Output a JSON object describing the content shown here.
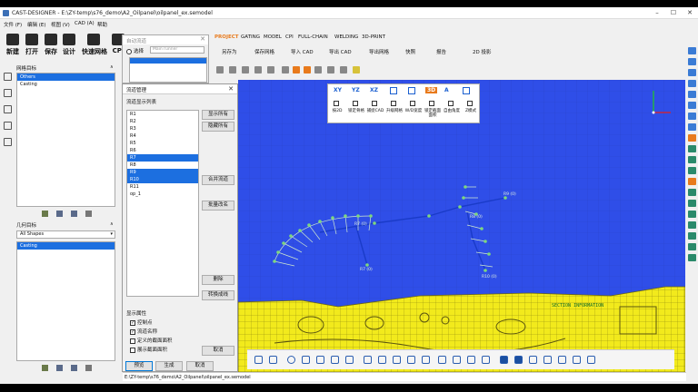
{
  "window": {
    "title": "CAST-DESIGNER - E:\\ZY-temp\\s76_demo\\A2_Oilpanel\\oilpanel_ex.semodel"
  },
  "menu": [
    "文件 (F)",
    "编辑 (E)",
    "视图 (V)",
    "CAD (A)",
    "帮助"
  ],
  "main_toolbar": [
    "新建",
    "打开",
    "保存",
    "设计",
    "快速网格",
    "CPI"
  ],
  "module_tabs": [
    "PROJECT",
    "GATING",
    "MODEL",
    "CPI",
    "FULL-CHAIN",
    "WELDING",
    "3D-PRINT"
  ],
  "quick_toolbar": [
    "另存为",
    "保存网格",
    "导入 CAD",
    "导出 CAD",
    "导出网格",
    "快照",
    "报告",
    "2D 投影"
  ],
  "mesh_panel": {
    "title": "网格目标",
    "items": [
      {
        "label": "Others",
        "selected": true
      },
      {
        "label": "Casting",
        "selected": false
      }
    ]
  },
  "geometry_panel": {
    "title": "几何目标",
    "filter": "All Shapes",
    "items": [
      {
        "label": "Casting",
        "selected": true
      }
    ]
  },
  "auto_runner_dialog": {
    "title": "自动流道",
    "radio_label": "选择",
    "select_value": "Main runner"
  },
  "runner_dialog": {
    "title": "流道管理",
    "list_title": "流道显示列表",
    "items": [
      {
        "label": "R1",
        "selected": false
      },
      {
        "label": "R2",
        "selected": false
      },
      {
        "label": "R3",
        "selected": false
      },
      {
        "label": "R4",
        "selected": false
      },
      {
        "label": "R5",
        "selected": false
      },
      {
        "label": "R6",
        "selected": false
      },
      {
        "label": "R7",
        "selected": true
      },
      {
        "label": "R8",
        "selected": false
      },
      {
        "label": "R9",
        "selected": true
      },
      {
        "label": "R10",
        "selected": true
      },
      {
        "label": "R11",
        "selected": false
      },
      {
        "label": "op_1",
        "selected": false
      }
    ],
    "buttons": {
      "show_all": "显示所有",
      "hide_all": "隐藏所有",
      "merge": "合并流道",
      "batch_rename": "批量改名",
      "delete": "删除",
      "convert": "转换成线"
    },
    "display_title": "显示属性",
    "checkboxes": [
      {
        "label": "控制点",
        "checked": true
      },
      {
        "label": "流道名称",
        "checked": true
      },
      {
        "label": "定义的截面面积",
        "checked": false
      },
      {
        "label": "展示截面面积",
        "checked": false
      }
    ],
    "cancel_inner": "取消",
    "footer": {
      "preview": "预览",
      "generate": "生成",
      "cancel": "取消"
    }
  },
  "view_panel": {
    "buttons": [
      "XY",
      "YZ",
      "XZ",
      "",
      "",
      "3D",
      "A",
      ""
    ],
    "labels": [
      "按2D",
      "锁定骨格",
      "捕捉CAD",
      "升级网格",
      "W/D宽度",
      "锁定截面面积",
      "自由角度",
      "Z模式"
    ]
  },
  "viewport_labels": {
    "runner_a": "R7 (0)",
    "runner_b": "R7 (0)",
    "runner_c": "R8 (0)",
    "runner_d": "R9 (0)",
    "runner_e": "R10 (0)",
    "overlay": "SECTION INFORMATION"
  },
  "status": {
    "path": "E:\\ZY-temp\\s76_demo\\A2_Oilpanel\\oilpanel_ex.semodel"
  },
  "colors": {
    "viewport_bg": "#2f4ee8",
    "part": "#f2ea1c",
    "runner_line": "#1a3bc8",
    "selection": "#1c6fe0",
    "accent_orange": "#e87a1c"
  }
}
